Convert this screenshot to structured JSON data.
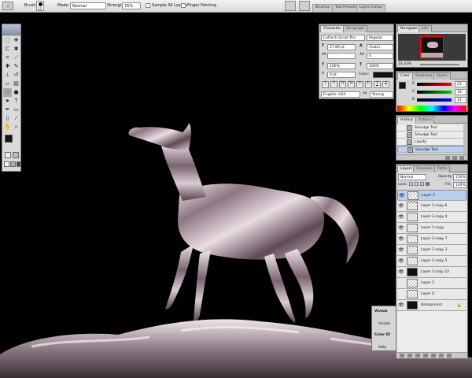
{
  "options_bar": {
    "brush_label": "Brush:",
    "brush_size": "25",
    "mode_label": "Mode:",
    "mode_value": "Normal",
    "strength_label": "Strength:",
    "strength_value": "76%",
    "sample_all_layers": "Sample All Layers",
    "finger_painting": "Finger Painting",
    "well_tabs": [
      "Brushes",
      "Tool Presets",
      "Layer Comps"
    ]
  },
  "character": {
    "tabs": [
      "Character",
      "Paragraph"
    ],
    "font_family": "Caflisch Script Pro",
    "font_style": "Regular",
    "font_size": "27.89 pt",
    "leading": "(Auto)",
    "kerning": "0",
    "vscale": "100%",
    "hscale": "100%",
    "baseline": "0 pt",
    "color_label": "Color:",
    "style_buttons": [
      "T",
      "T",
      "TT",
      "Tт",
      "T¹",
      "T₁",
      "T",
      "T"
    ],
    "language": "English: USA",
    "aa": "aa",
    "antialias": "Strong"
  },
  "navigator": {
    "tabs": [
      "Navigator",
      "Info"
    ],
    "zoom": "33.33%"
  },
  "color": {
    "tabs": [
      "Color",
      "Swatches",
      "Styles"
    ],
    "r": "23",
    "g": "19",
    "b": "12"
  },
  "history": {
    "tabs": [
      "History",
      "Actions"
    ],
    "items": [
      "Smudge Tool",
      "Smudge Tool",
      "Liquify",
      "Smudge Tool"
    ]
  },
  "layers": {
    "tabs": [
      "Layers",
      "Channels",
      "Paths"
    ],
    "blend_mode": "Normal",
    "opacity_label": "Opacity:",
    "opacity": "100%",
    "lock_label": "Lock:",
    "fill_label": "Fill:",
    "fill": "100%",
    "items": [
      {
        "name": "Layer 2",
        "selected": true
      },
      {
        "name": "Layer 3 copy 6",
        "selected": false
      },
      {
        "name": "Layer 3 copy 4",
        "selected": false
      },
      {
        "name": "Layer 3 copy",
        "selected": false
      },
      {
        "name": "Layer 3 copy 7",
        "selected": false
      },
      {
        "name": "Layer 3 copy 3",
        "selected": false
      },
      {
        "name": "Layer 3 copy 5",
        "selected": false
      },
      {
        "name": "Layer 3 copy 12",
        "selected": false
      },
      {
        "name": "Layer 3",
        "selected": false
      },
      {
        "name": "Layer 4",
        "selected": false
      },
      {
        "name": "Background",
        "selected": false
      }
    ]
  },
  "viveza": {
    "header": "Viveza",
    "title": "Viveza",
    "color_el": "Color Ef",
    "help": "Help"
  },
  "colors": {
    "selection": "#b8cff2",
    "panel": "#d6d6d6",
    "foreground": "#17130c"
  }
}
